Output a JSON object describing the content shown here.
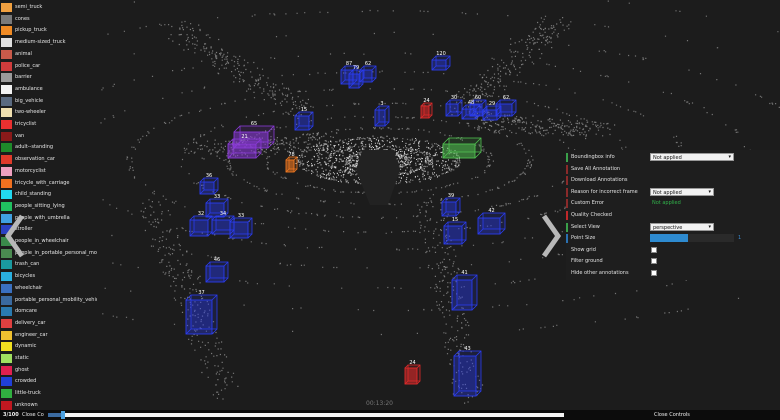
{
  "legend": {
    "items": [
      {
        "label": "semi_truck",
        "color": "#f0a040"
      },
      {
        "label": "cones",
        "color": "#7a7a7a"
      },
      {
        "label": "pickup_truck",
        "color": "#f08b25"
      },
      {
        "label": "medium-sized_truck",
        "color": "#e0e0e0"
      },
      {
        "label": "animal",
        "color": "#c85a4a"
      },
      {
        "label": "police_car",
        "color": "#d03c3c"
      },
      {
        "label": "barrier",
        "color": "#9a9a9a"
      },
      {
        "label": "ambulance",
        "color": "#f2f2f2"
      },
      {
        "label": "big_vehicle",
        "color": "#5a6a80"
      },
      {
        "label": "two-wheeler",
        "color": "#f0e0b0"
      },
      {
        "label": "tricyclist",
        "color": "#e83030"
      },
      {
        "label": "van",
        "color": "#8a1a1a"
      },
      {
        "label": "adult--standing",
        "color": "#1e8a2a"
      },
      {
        "label": "observation_car",
        "color": "#e03a2a"
      },
      {
        "label": "motorcyclist",
        "color": "#f0a0c0"
      },
      {
        "label": "tricycle_with_carriage",
        "color": "#f07020"
      },
      {
        "label": "child_standing",
        "color": "#22d8f0"
      },
      {
        "label": "people_sitting_lying",
        "color": "#20c060"
      },
      {
        "label": "people_with_umbrella",
        "color": "#40a0e0"
      },
      {
        "label": "stroller",
        "color": "#2a40c0"
      },
      {
        "label": "people_in_wheelchair",
        "color": "#3a8a4a"
      },
      {
        "label": "people_in_portable_personal_mo...",
        "color": "#4a8a50"
      },
      {
        "label": "trash_can",
        "color": "#1a9aa0"
      },
      {
        "label": "bicycles",
        "color": "#2ab0e0"
      },
      {
        "label": "wheelchair",
        "color": "#3a70c0"
      },
      {
        "label": "portable_personal_mobility_vehicle",
        "color": "#3a6aa0"
      },
      {
        "label": "domcare",
        "color": "#2a7ab0"
      },
      {
        "label": "delivery_car",
        "color": "#e04040"
      },
      {
        "label": "engineer_car",
        "color": "#f0c030"
      },
      {
        "label": "dynamic",
        "color": "#f0e020"
      },
      {
        "label": "static",
        "color": "#a0e060"
      },
      {
        "label": "ghost",
        "color": "#e02050"
      },
      {
        "label": "crowded",
        "color": "#2040d8"
      },
      {
        "label": "little-truck",
        "color": "#30b040"
      },
      {
        "label": "unknown",
        "color": "#c01820"
      }
    ]
  },
  "controls": {
    "rows": [
      {
        "label": "Boundingbox info",
        "mark": "#3aa04a",
        "type": "select",
        "value": "Not applied"
      },
      {
        "label": "Save All Annotation",
        "mark": "#8a2a2a",
        "type": "none"
      },
      {
        "label": "Download Annotations",
        "mark": "#8a2a2a",
        "type": "none"
      },
      {
        "label": "Reason for incorrect frame",
        "mark": "#8a2a2a",
        "type": "select-small",
        "value": "Not applied"
      },
      {
        "label": "Custom Error",
        "mark": "#8a2a2a",
        "type": "green",
        "value": "Not applied"
      },
      {
        "label": "Quality Checked",
        "mark": "#c0282a",
        "type": "none"
      },
      {
        "label": "Select View",
        "mark": "#3aa04a",
        "type": "select-small",
        "value": "perspective"
      },
      {
        "label": "Point Size",
        "mark": "#2a70b0",
        "type": "slider",
        "fill": 0.45,
        "value": "1"
      },
      {
        "label": "Show grid",
        "mark": "",
        "type": "check"
      },
      {
        "label": "Filter ground",
        "mark": "",
        "type": "check"
      },
      {
        "label": "Hide other annotations",
        "mark": "",
        "type": "check"
      }
    ],
    "close_label": "Close Controls"
  },
  "bottom": {
    "frame": "3/100",
    "close_label": "Close Co",
    "timestamp": "00:13:20",
    "progress": 0.03
  },
  "boxes": [
    {
      "id": "120",
      "color": "blue"
    },
    {
      "id": "87",
      "color": "blue"
    },
    {
      "id": "62",
      "color": "blue"
    },
    {
      "id": "79",
      "color": "blue"
    },
    {
      "id": "3",
      "color": "blue"
    },
    {
      "id": "24",
      "color": "red"
    },
    {
      "id": "30",
      "color": "blue"
    },
    {
      "id": "60",
      "color": "blue"
    },
    {
      "id": "48",
      "color": "blue"
    },
    {
      "id": "29",
      "color": "blue"
    },
    {
      "id": "62",
      "color": "blue"
    },
    {
      "id": "15",
      "color": "blue"
    },
    {
      "id": "65",
      "color": "purple"
    },
    {
      "id": "21",
      "color": "purple"
    },
    {
      "id": "78",
      "color": "orange"
    },
    {
      "id": "36",
      "color": "blue"
    },
    {
      "id": "33",
      "color": "blue"
    },
    {
      "id": "39",
      "color": "blue"
    },
    {
      "id": "42",
      "color": "blue"
    },
    {
      "id": "32",
      "color": "blue"
    },
    {
      "id": "34",
      "color": "blue"
    },
    {
      "id": "33",
      "color": "blue"
    },
    {
      "id": "15",
      "color": "blue"
    },
    {
      "id": "46",
      "color": "blue"
    },
    {
      "id": "37",
      "color": "blue"
    },
    {
      "id": "41",
      "color": "blue"
    },
    {
      "id": "43",
      "color": "blue"
    },
    {
      "id": "24",
      "color": "red"
    },
    {
      "id": "",
      "color": "green"
    }
  ]
}
